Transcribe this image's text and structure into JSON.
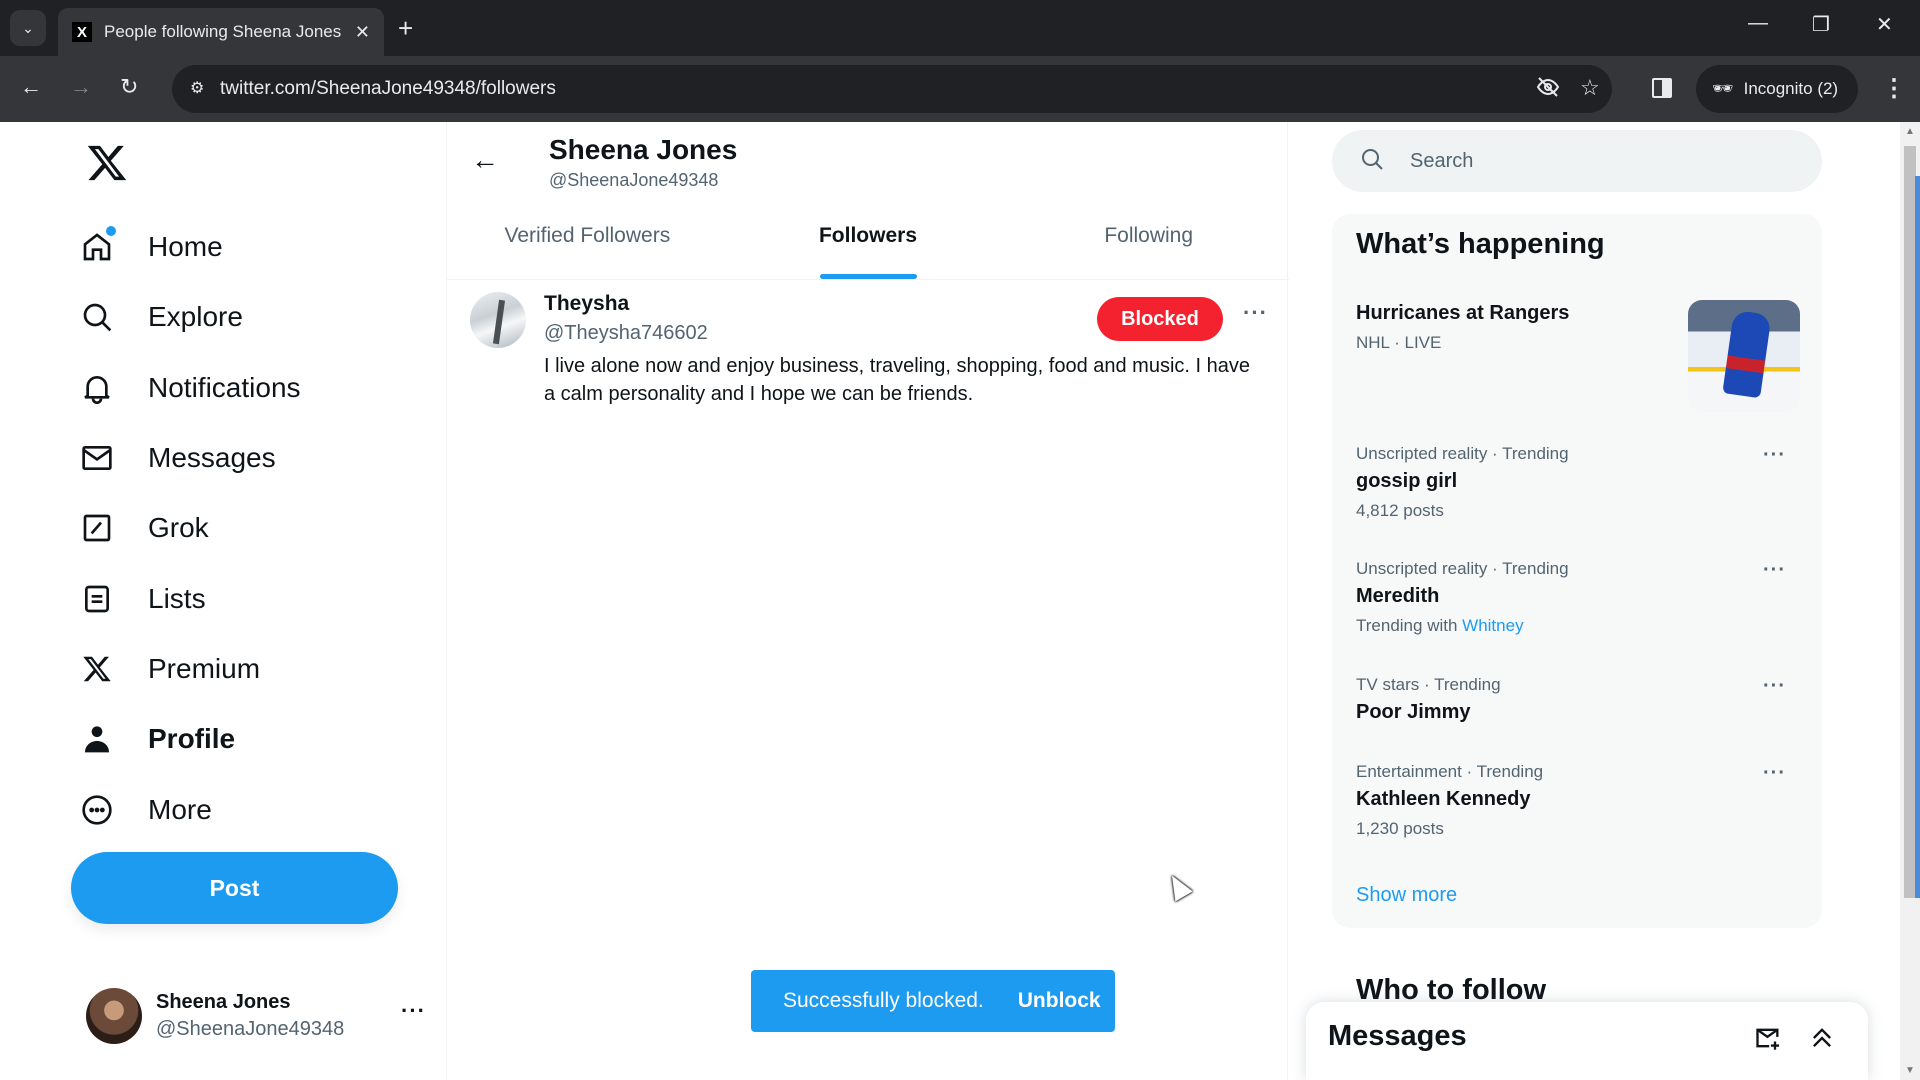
{
  "browser": {
    "tab_title": "People following Sheena Jones",
    "tab_favicon": "X",
    "url": "twitter.com/SheenaJone49348/followers",
    "incognito_label": "Incognito (2)"
  },
  "sidebar": {
    "items": [
      {
        "label": "Home",
        "icon": "home-icon",
        "has_dot": true
      },
      {
        "label": "Explore",
        "icon": "search-icon"
      },
      {
        "label": "Notifications",
        "icon": "bell-icon"
      },
      {
        "label": "Messages",
        "icon": "mail-icon"
      },
      {
        "label": "Grok",
        "icon": "grok-icon"
      },
      {
        "label": "Lists",
        "icon": "list-icon"
      },
      {
        "label": "Premium",
        "icon": "x-logo-icon"
      },
      {
        "label": "Profile",
        "icon": "person-icon",
        "active": true
      },
      {
        "label": "More",
        "icon": "more-circle-icon"
      }
    ],
    "post_label": "Post",
    "account": {
      "name": "Sheena Jones",
      "handle": "@SheenaJone49348"
    }
  },
  "header": {
    "name": "Sheena Jones",
    "handle": "@SheenaJone49348"
  },
  "tabs": [
    {
      "label": "Verified Followers",
      "active": false
    },
    {
      "label": "Followers",
      "active": true
    },
    {
      "label": "Following",
      "active": false
    }
  ],
  "followers": [
    {
      "name": "Theysha",
      "handle": "@Theysha746602",
      "bio": "I live alone now and enjoy business, traveling, shopping, food and music. I have a calm personality and I hope we can be friends.",
      "button_label": "Blocked"
    }
  ],
  "toast": {
    "message": "Successfully blocked.",
    "action": "Unblock"
  },
  "right": {
    "search_placeholder": "Search",
    "trends_title": "What’s happening",
    "featured": {
      "title": "Hurricanes at Rangers",
      "meta": "NHL · LIVE"
    },
    "trends": [
      {
        "meta": "Unscripted reality · Trending",
        "title": "gossip girl",
        "sub": "4,812 posts"
      },
      {
        "meta": "Unscripted reality · Trending",
        "title": "Meredith",
        "sub_prefix": "Trending with",
        "sub_link": "Whitney"
      },
      {
        "meta": "TV stars · Trending",
        "title": "Poor Jimmy"
      },
      {
        "meta": "Entertainment · Trending",
        "title": "Kathleen Kennedy",
        "sub": "1,230 posts"
      }
    ],
    "show_more": "Show more",
    "who_to_follow": "Who to follow",
    "messages_title": "Messages"
  },
  "colors": {
    "accent": "#1d9bf0",
    "blocked": "#f4212e",
    "text": "#0f1419",
    "muted": "#536471"
  }
}
